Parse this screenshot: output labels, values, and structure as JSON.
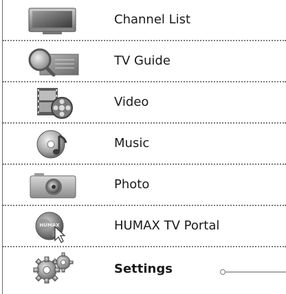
{
  "menu": {
    "items": [
      {
        "label": "Channel List",
        "icon": "tv-screen-icon"
      },
      {
        "label": "TV Guide",
        "icon": "magnifier-guide-icon"
      },
      {
        "label": "Video",
        "icon": "film-reel-icon"
      },
      {
        "label": "Music",
        "icon": "music-disc-icon"
      },
      {
        "label": "Photo",
        "icon": "camera-icon"
      },
      {
        "label": "HUMAX TV Portal",
        "icon": "portal-globe-icon",
        "icon_text": "HUMAX"
      },
      {
        "label": "Settings",
        "icon": "gears-icon",
        "selected": true
      }
    ]
  }
}
